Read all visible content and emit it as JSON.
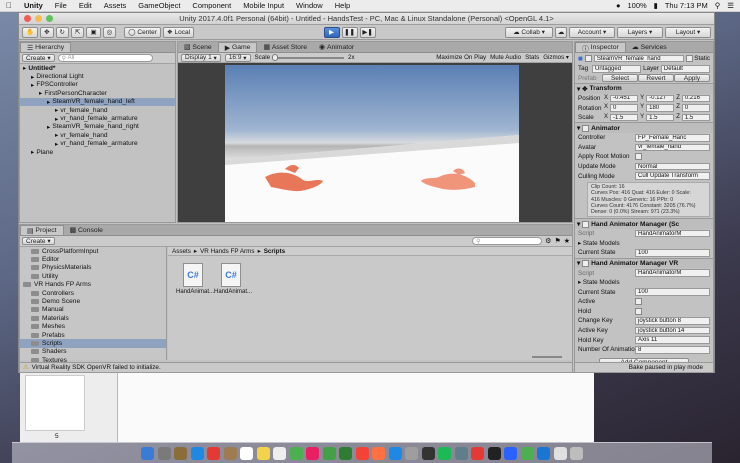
{
  "menubar": {
    "app": "Unity",
    "items": [
      "File",
      "Edit",
      "Assets",
      "GameObject",
      "Component",
      "Mobile Input",
      "Window",
      "Help"
    ],
    "battery": "100%",
    "clock": "Thu 7:13 PM"
  },
  "window": {
    "title": "Unity 2017.4.0f1 Personal (64bit) - Untitled - HandsTest - PC, Mac & Linux Standalone (Personal) <OpenGL 4.1>"
  },
  "toolbar": {
    "center": "Center",
    "local": "Local",
    "collab": "Collab",
    "account": "Account",
    "layers": "Layers",
    "layout": "Layout"
  },
  "hierarchy": {
    "tab": "Hierarchy",
    "create": "Create",
    "search_placeholder": "All",
    "items": [
      {
        "label": "Untitled*",
        "indent": 0,
        "bold": true
      },
      {
        "label": "Directional Light",
        "indent": 1
      },
      {
        "label": "FPSController",
        "indent": 1
      },
      {
        "label": "FirstPersonCharacter",
        "indent": 2
      },
      {
        "label": "SteamVR_female_hand_left",
        "indent": 3,
        "selected": true
      },
      {
        "label": "vr_female_hand",
        "indent": 4
      },
      {
        "label": "vr_hand_female_armature",
        "indent": 4
      },
      {
        "label": "SteamVR_female_hand_right",
        "indent": 3
      },
      {
        "label": "vr_female_hand",
        "indent": 4
      },
      {
        "label": "vr_hand_female_armature",
        "indent": 4
      },
      {
        "label": "Plane",
        "indent": 1
      }
    ]
  },
  "scene_tabs": {
    "scene": "Scene",
    "game": "Game",
    "asset_store": "Asset Store",
    "animator": "Animator"
  },
  "game_bar": {
    "display": "Display 1",
    "aspect": "16:9",
    "scale_label": "Scale",
    "scale_value": "2x",
    "maximize": "Maximize On Play",
    "mute": "Mute Audio",
    "stats": "Stats",
    "gizmos": "Gizmos"
  },
  "project": {
    "tab_project": "Project",
    "tab_console": "Console",
    "create": "Create",
    "tree": [
      {
        "label": "CrossPlatformInput",
        "indent": 1
      },
      {
        "label": "Editor",
        "indent": 1
      },
      {
        "label": "PhysicsMaterials",
        "indent": 1
      },
      {
        "label": "Utility",
        "indent": 1
      },
      {
        "label": "VR Hands FP Arms",
        "indent": 0
      },
      {
        "label": "Controllers",
        "indent": 1
      },
      {
        "label": "Demo Scene",
        "indent": 1
      },
      {
        "label": "Manual",
        "indent": 1
      },
      {
        "label": "Materials",
        "indent": 1
      },
      {
        "label": "Meshes",
        "indent": 1
      },
      {
        "label": "Prefabs",
        "indent": 1
      },
      {
        "label": "Scripts",
        "indent": 1,
        "selected": true
      },
      {
        "label": "Shaders",
        "indent": 1
      },
      {
        "label": "Textures",
        "indent": 1
      }
    ],
    "breadcrumb": [
      "Assets",
      "VR Hands FP Arms",
      "Scripts"
    ],
    "files": [
      "HandAnimat...",
      "HandAnimat..."
    ],
    "status": "Virtual Reality SDK OpenVR failed to initialize."
  },
  "inspector": {
    "tab_inspector": "Inspector",
    "tab_services": "Services",
    "object_name": "SteamVR_female_hand_",
    "static": "Static",
    "tag_label": "Tag",
    "tag_value": "Untagged",
    "layer_label": "Layer",
    "layer_value": "Default",
    "prefab_label": "Prefab",
    "prefab_select": "Select",
    "prefab_revert": "Revert",
    "prefab_apply": "Apply",
    "transform": {
      "title": "Transform",
      "position_label": "Position",
      "position": [
        "-0.451",
        "-0.127",
        "0.216"
      ],
      "rotation_label": "Rotation",
      "rotation": [
        "0",
        "180",
        "0"
      ],
      "scale_label": "Scale",
      "scale": [
        "-1.5",
        "1.5",
        "1.5"
      ]
    },
    "animator": {
      "title": "Animator",
      "controller_label": "Controller",
      "controller": "FP_Female_Hanc",
      "avatar_label": "Avatar",
      "avatar": "vr_female_hand",
      "root_motion_label": "Apply Root Motion",
      "update_mode_label": "Update Mode",
      "update_mode": "Normal",
      "culling_label": "Culling Mode",
      "culling": "Cull Update Transform",
      "info": [
        "Clip Count: 16",
        "Curves Pos: 416 Quat: 416 Euler: 0 Scale:",
        "416 Muscles: 0 Generic: 16 PPtr: 0",
        "Curves Count: 4176 Constant: 3205 (76.7%)",
        "Dense: 0 (0.0%) Stream: 971 (23.3%)"
      ]
    },
    "ham_sc": {
      "title": "Hand Animator Manager (Sc",
      "script_label": "Script",
      "script": "HandAnimatorM",
      "state_models": "State Models",
      "current_state_label": "Current State",
      "current_state": "100"
    },
    "ham_vr": {
      "title": "Hand Animator Manager VR",
      "script_label": "Script",
      "script": "HandAnimatorM",
      "state_models": "State Models",
      "current_state_label": "Current State",
      "current_state": "100",
      "active_label": "Active",
      "hold_label": "Hold",
      "change_key_label": "Change Key",
      "change_key": "joystick button 8",
      "active_key_label": "Active Key",
      "active_key": "joystick button 14",
      "hold_key_label": "Hold Key",
      "hold_key": "Axis 11",
      "num_anim_label": "Number Of Animation",
      "num_anim": "8"
    },
    "add_component": "Add Component",
    "bake_status": "Bake paused in play mode"
  },
  "background": {
    "page_number": "5"
  }
}
